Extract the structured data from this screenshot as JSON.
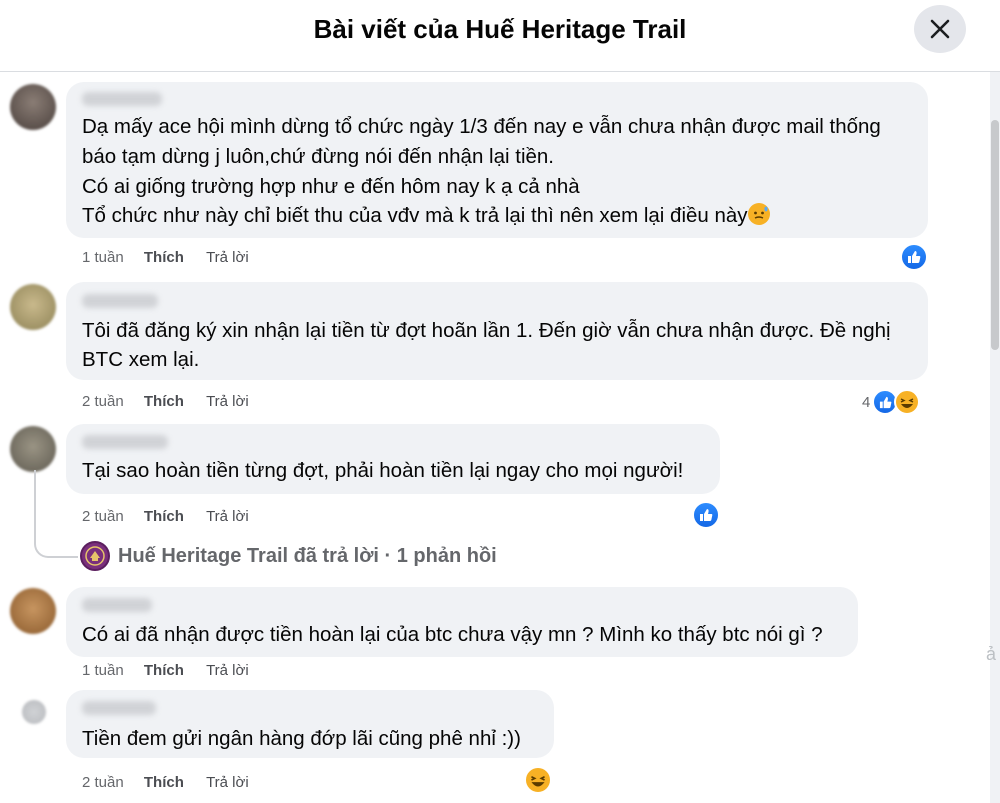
{
  "header": {
    "title": "Bài viết của Huế Heritage Trail"
  },
  "comments": [
    {
      "lines": [
        "Dạ mấy ace hội mình dừng tổ chức ngày 1/3 đến nay e vẫn chưa nhận được mail thống",
        "báo tạm dừng j luôn,chứ đừng nói đến nhận lại tiền.",
        "Có ai giống trường hợp như e đến hôm nay k ạ cả nhà",
        "Tổ chức như này chỉ biết thu của vđv mà k trả lại thì nên xem lại điều này"
      ],
      "time": "1 tuần",
      "like_label": "Thích",
      "reply_label": "Trả lời"
    },
    {
      "lines": [
        "Tôi đã đăng ký xin nhận lại tiền từ đợt hoãn lần 1. Đến giờ vẫn chưa nhận được. Đề nghị",
        "BTC xem lại."
      ],
      "time": "2 tuần",
      "like_label": "Thích",
      "reply_label": "Trả lời",
      "reaction_count": "4"
    },
    {
      "lines": [
        "Tại sao hoàn tiền từng đợt, phải hoàn tiền lại ngay cho mọi người!"
      ],
      "time": "2 tuần",
      "like_label": "Thích",
      "reply_label": "Trả lời"
    },
    {
      "lines": [
        "Có ai đã nhận được tiền hoàn lại của btc chưa vậy mn ? Mình ko thấy btc nói gì ?"
      ],
      "time": "1 tuần",
      "like_label": "Thích",
      "reply_label": "Trả lời"
    },
    {
      "lines": [
        "Tiền đem gửi ngân hàng đớp lãi cũng phê nhỉ :))"
      ],
      "time": "2 tuần",
      "like_label": "Thích",
      "reply_label": "Trả lời"
    }
  ],
  "page_reply": {
    "text": "Huế Heritage Trail đã trả lời · 1 phản hồi"
  },
  "colors": {
    "like_blue": "#1877f2",
    "haha_yellow": "#f7b125",
    "bubble": "#f0f2f5",
    "meta_gray": "#65676b"
  },
  "icons": {
    "close": "close-icon",
    "like": "like-reaction-icon",
    "haha": "haha-reaction-icon"
  }
}
